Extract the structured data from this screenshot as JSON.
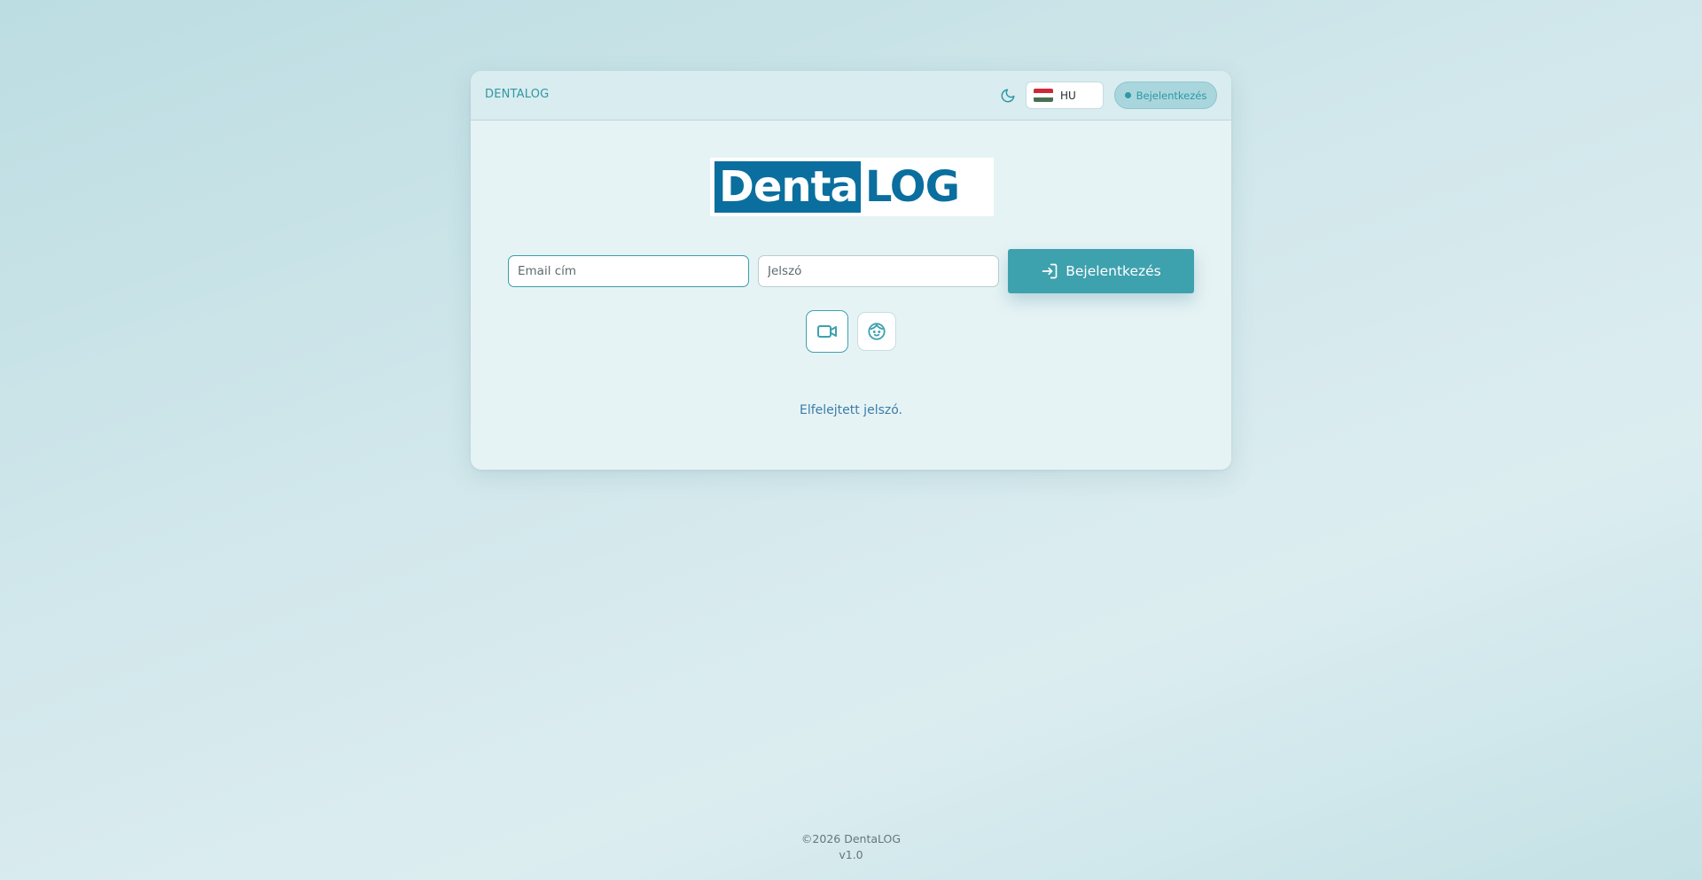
{
  "header": {
    "brand": "DENTALOG",
    "theme_icon": "moon-icon",
    "language": {
      "flag": "hungary-flag",
      "selected": "HU",
      "flag_colors": [
        "#ce2939",
        "#ffffff",
        "#477050"
      ]
    },
    "login_label": "Bejelentkezés"
  },
  "logo": {
    "part1": "Denta",
    "part2": "LOG"
  },
  "form": {
    "email_placeholder": "Email cím",
    "password_placeholder": "Jelszó",
    "login_button_label": "Bejelentkezés",
    "login_icon": "login-arrow-icon"
  },
  "alt_login": {
    "video_icon": "video-camera-icon",
    "face_icon": "face-icon"
  },
  "forgot_password": "Elfelejtett jelszó.",
  "footer": {
    "copyright": "©2026 DentaLOG",
    "version": "v1.0"
  },
  "colors": {
    "accent": "#3ea1ae",
    "brand_blue": "#0a6f9e",
    "link": "#3a7ca8"
  }
}
